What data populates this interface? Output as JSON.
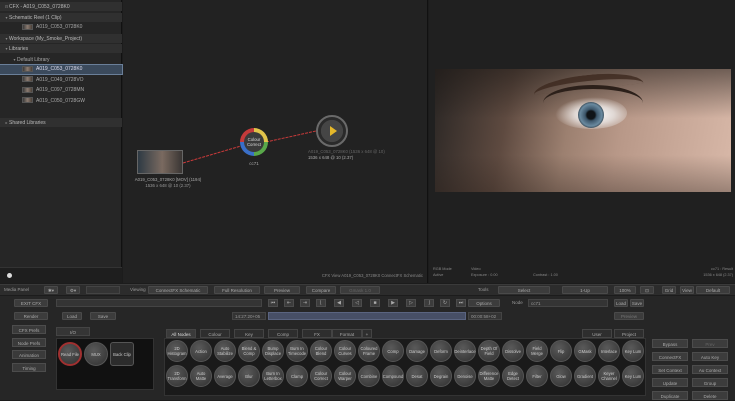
{
  "tree": {
    "rows": [
      {
        "text": "CFX - A019_C053_0728K0",
        "hdr": true,
        "tw": "⊟"
      },
      {
        "text": "Schematic Reel (1 Clip)",
        "hdr": true,
        "tw": "▾"
      },
      {
        "text": "A019_C053_0728K0",
        "thumb": true
      },
      {
        "text": "Workspace (My_Smoke_Project)",
        "hdr": true,
        "tw": "▾"
      },
      {
        "text": "Libraries",
        "hdr": true,
        "tw": "▾"
      },
      {
        "text": "Default Library",
        "tw": "▾"
      },
      {
        "text": "A019_C053_0728K0",
        "thumb": true,
        "sel": true
      },
      {
        "text": "A019_C049_0728VO",
        "thumb": true
      },
      {
        "text": "A019_C097_0728MN",
        "thumb": true
      },
      {
        "text": "A019_C050_0728GW",
        "thumb": true
      },
      {
        "text": "",
        "gap": true
      },
      {
        "text": "Shared Libraries",
        "hdr": true,
        "tw": "▸"
      }
    ]
  },
  "schematic": {
    "clip_label": "A019_C053_0728K0 [MOV] (1194)",
    "clip_res": "1536 x 648 @ 10 (2.37)",
    "cc_label": "Colour Correct",
    "cc_name": "cc71",
    "out_label": "A019_C053_0728K0 (1536 x 648 @ 10)",
    "out_res": "1536 x 648 @ 10 (2.37)",
    "footer": "CFX View  A019_C053_0728K0  ConnectFX Schematic"
  },
  "viewer": {
    "info_left": [
      "RGB Mode",
      "Active"
    ],
    "info_mid": [
      "Video",
      "Exposure : 0.00"
    ],
    "info_mid2": "Contrast : 1.00",
    "info_right": [
      "cc71 : Result",
      "1536 x 648 (2.37)"
    ]
  },
  "toolbar": {
    "media_panel": "Media Panel",
    "viewing": "Viewing",
    "view_mode": "ConnectFX Schematic",
    "resolution": "Full Resolution",
    "preview": "Preview",
    "compare": "Compare",
    "compare_mode": "Gmask 1.0",
    "tools": "Tools",
    "tools_mode": "Select",
    "layout": "1-Up",
    "zoom": "100%",
    "grid": "Grid",
    "view": "View",
    "view_default": "Default"
  },
  "controls": {
    "exit": "EXIT CFX",
    "render": "Render",
    "load": "Load",
    "save": "Save",
    "timecode_in": "14:27:20+05",
    "timecode_out": "00:00:58+02",
    "options": "Options",
    "node_label": "Node",
    "node_value": "cc71",
    "load2": "Load",
    "save2": "Save",
    "preview2": "Preview"
  },
  "sidebar": [
    "CFX Prefs",
    "Node Prefs",
    "Animation",
    "Timing"
  ],
  "io_tab": "I/O",
  "io_nodes": [
    "Read File",
    "MUX",
    "Back Clip"
  ],
  "tabs": [
    "All Nodes",
    "Colour",
    "Key",
    "Comp",
    "FX",
    "Format"
  ],
  "tabs_right": [
    "User",
    "Project"
  ],
  "nodes_row1": [
    "2D Histogram",
    "Action",
    "Auto Stabilize",
    "Blend & Comp",
    "Bump Displace",
    "Burn In Timecode",
    "Colour Blend",
    "Colour Curves",
    "Coloured Frame",
    "Comp",
    "Damage",
    "Deform",
    "Deinterlace",
    "Depth Of Field",
    "Dissolve",
    "Field Merge",
    "Flip",
    "GMask",
    "Interlace",
    "Key Lum"
  ],
  "nodes_row2": [
    "2D Transform",
    "Auto Matte",
    "Average",
    "Blur",
    "Burn In Letterbox",
    "Clamp",
    "Colour Correct",
    "Colour Warper",
    "Combine",
    "Compound",
    "Desat",
    "Degrain",
    "Denoise",
    "Difference Matte",
    "Edge Detect",
    "Filter",
    "Glow",
    "Gradient",
    "Keyer Channel",
    "Key Lum"
  ],
  "right_buttons": [
    "Bypass",
    "Prev",
    "ConnectFX",
    "Auto Key",
    "Set Context",
    "Au Context",
    "Update",
    "Group",
    "Duplicate",
    "Delete"
  ]
}
